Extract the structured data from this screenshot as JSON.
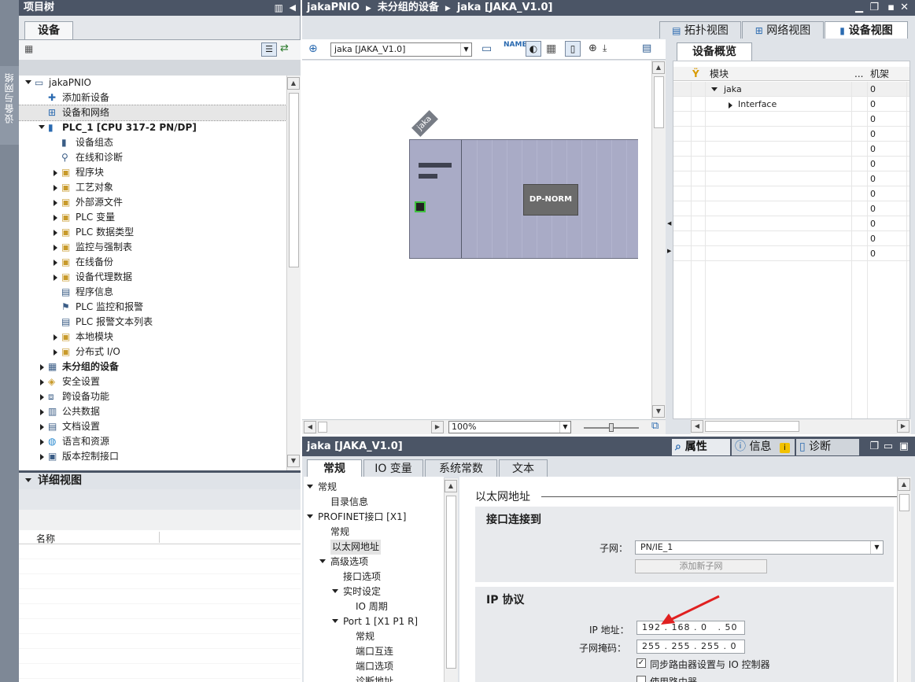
{
  "left_panel": {
    "title": "项目树",
    "side_tab": "设备与网络",
    "tab": "设备",
    "tree": [
      {
        "label": "jakaPNIO",
        "level": 0,
        "expand": "down",
        "icon": "project-icon"
      },
      {
        "label": "添加新设备",
        "level": 1,
        "expand": "",
        "icon": "add-device-icon"
      },
      {
        "label": "设备和网络",
        "level": 1,
        "expand": "",
        "icon": "network-icon",
        "selected": true
      },
      {
        "label": "PLC_1 [CPU 317-2 PN/DP]",
        "level": 1,
        "expand": "down",
        "icon": "plc-icon",
        "bold": true
      },
      {
        "label": "设备组态",
        "level": 2,
        "expand": "",
        "icon": "device-config-icon"
      },
      {
        "label": "在线和诊断",
        "level": 2,
        "expand": "",
        "icon": "diagnostics-icon"
      },
      {
        "label": "程序块",
        "level": 2,
        "expand": "right",
        "icon": "folder-icon"
      },
      {
        "label": "工艺对象",
        "level": 2,
        "expand": "right",
        "icon": "folder-icon"
      },
      {
        "label": "外部源文件",
        "level": 2,
        "expand": "right",
        "icon": "folder-icon"
      },
      {
        "label": "PLC 变量",
        "level": 2,
        "expand": "right",
        "icon": "folder-icon"
      },
      {
        "label": "PLC 数据类型",
        "level": 2,
        "expand": "right",
        "icon": "folder-icon"
      },
      {
        "label": "监控与强制表",
        "level": 2,
        "expand": "right",
        "icon": "folder-icon"
      },
      {
        "label": "在线备份",
        "level": 2,
        "expand": "right",
        "icon": "folder-icon"
      },
      {
        "label": "设备代理数据",
        "level": 2,
        "expand": "right",
        "icon": "folder-icon"
      },
      {
        "label": "程序信息",
        "level": 2,
        "expand": "",
        "icon": "program-info-icon"
      },
      {
        "label": "PLC 监控和报警",
        "level": 2,
        "expand": "",
        "icon": "alarm-icon"
      },
      {
        "label": "PLC 报警文本列表",
        "level": 2,
        "expand": "",
        "icon": "text-list-icon"
      },
      {
        "label": "本地模块",
        "level": 2,
        "expand": "right",
        "icon": "folder-icon"
      },
      {
        "label": "分布式 I/O",
        "level": 2,
        "expand": "right",
        "icon": "folder-icon"
      },
      {
        "label": "未分组的设备",
        "level": 1,
        "expand": "right",
        "icon": "ungrouped-icon",
        "bold": true
      },
      {
        "label": "安全设置",
        "level": 1,
        "expand": "right",
        "icon": "security-icon"
      },
      {
        "label": "跨设备功能",
        "level": 1,
        "expand": "right",
        "icon": "cross-device-icon"
      },
      {
        "label": "公共数据",
        "level": 1,
        "expand": "right",
        "icon": "common-data-icon"
      },
      {
        "label": "文档设置",
        "level": 1,
        "expand": "right",
        "icon": "doc-settings-icon"
      },
      {
        "label": "语言和资源",
        "level": 1,
        "expand": "right",
        "icon": "language-icon"
      },
      {
        "label": "版本控制接口",
        "level": 1,
        "expand": "right",
        "icon": "version-control-icon"
      }
    ],
    "detail_title": "详细视图",
    "detail_column": "名称"
  },
  "header": {
    "breadcrumb": [
      "jakaPNIO",
      "未分组的设备",
      "jaka [JAKA_V1.0]"
    ]
  },
  "view_tabs": [
    "拓扑视图",
    "网络视图",
    "设备视图"
  ],
  "device_view": {
    "device_select": "jaka [JAKA_V1.0]",
    "device_label": "jaka",
    "module_label": "DP-NORM",
    "zoom": "100%"
  },
  "overview": {
    "tab": "设备概览",
    "columns": [
      "模块",
      "...",
      "机架"
    ],
    "rows": [
      {
        "module": "jaka",
        "rack": "0",
        "expand": "down",
        "indent": 1
      },
      {
        "module": "Interface",
        "rack": "0",
        "expand": "right",
        "indent": 2
      },
      {
        "module": "",
        "rack": "0"
      },
      {
        "module": "",
        "rack": "0"
      },
      {
        "module": "",
        "rack": "0"
      },
      {
        "module": "",
        "rack": "0"
      },
      {
        "module": "",
        "rack": "0"
      },
      {
        "module": "",
        "rack": "0"
      },
      {
        "module": "",
        "rack": "0"
      },
      {
        "module": "",
        "rack": "0"
      },
      {
        "module": "",
        "rack": "0"
      },
      {
        "module": "",
        "rack": "0"
      }
    ]
  },
  "properties": {
    "title": "jaka [JAKA_V1.0]",
    "panel_tabs": [
      "属性",
      "信息",
      "诊断"
    ],
    "tabs": [
      "常规",
      "IO 变量",
      "系统常数",
      "文本"
    ],
    "nav": [
      {
        "label": "常规",
        "level": 0,
        "expand": "down"
      },
      {
        "label": "目录信息",
        "level": 1,
        "expand": ""
      },
      {
        "label": "PROFINET接口 [X1]",
        "level": 0,
        "expand": "down"
      },
      {
        "label": "常规",
        "level": 1,
        "expand": ""
      },
      {
        "label": "以太网地址",
        "level": 1,
        "expand": "",
        "selected": true
      },
      {
        "label": "高级选项",
        "level": 1,
        "expand": "down"
      },
      {
        "label": "接口选项",
        "level": 2,
        "expand": ""
      },
      {
        "label": "实时设定",
        "level": 2,
        "expand": "down"
      },
      {
        "label": "IO 周期",
        "level": 3,
        "expand": ""
      },
      {
        "label": "Port 1 [X1 P1 R]",
        "level": 2,
        "expand": "down"
      },
      {
        "label": "常规",
        "level": 3,
        "expand": ""
      },
      {
        "label": "端口互连",
        "level": 3,
        "expand": ""
      },
      {
        "label": "端口选项",
        "level": 3,
        "expand": ""
      },
      {
        "label": "诊断地址",
        "level": 3,
        "expand": ""
      }
    ],
    "section_title": "以太网地址",
    "interface_heading": "接口连接到",
    "subnet_label": "子网：",
    "subnet_value": "PN/IE_1",
    "add_subnet_button": "添加新子网",
    "ip_heading": "IP 协议",
    "ip_label": "IP 地址：",
    "ip_value": [
      "192",
      "168",
      "0",
      "50"
    ],
    "mask_label": "子网掩码：",
    "mask_value": [
      "255",
      "255",
      "255",
      "0"
    ],
    "sync_router_label": "同步路由器设置与 IO 控制器",
    "use_router_label": "使用路由器"
  },
  "colors": {
    "title_bar": "#4b5566",
    "panel_bg": "#dfe3e8",
    "selection": "#cfe0f3",
    "device_body": "#a9abc6",
    "module_box": "#6b6b6b",
    "arrow": "#e02020"
  }
}
